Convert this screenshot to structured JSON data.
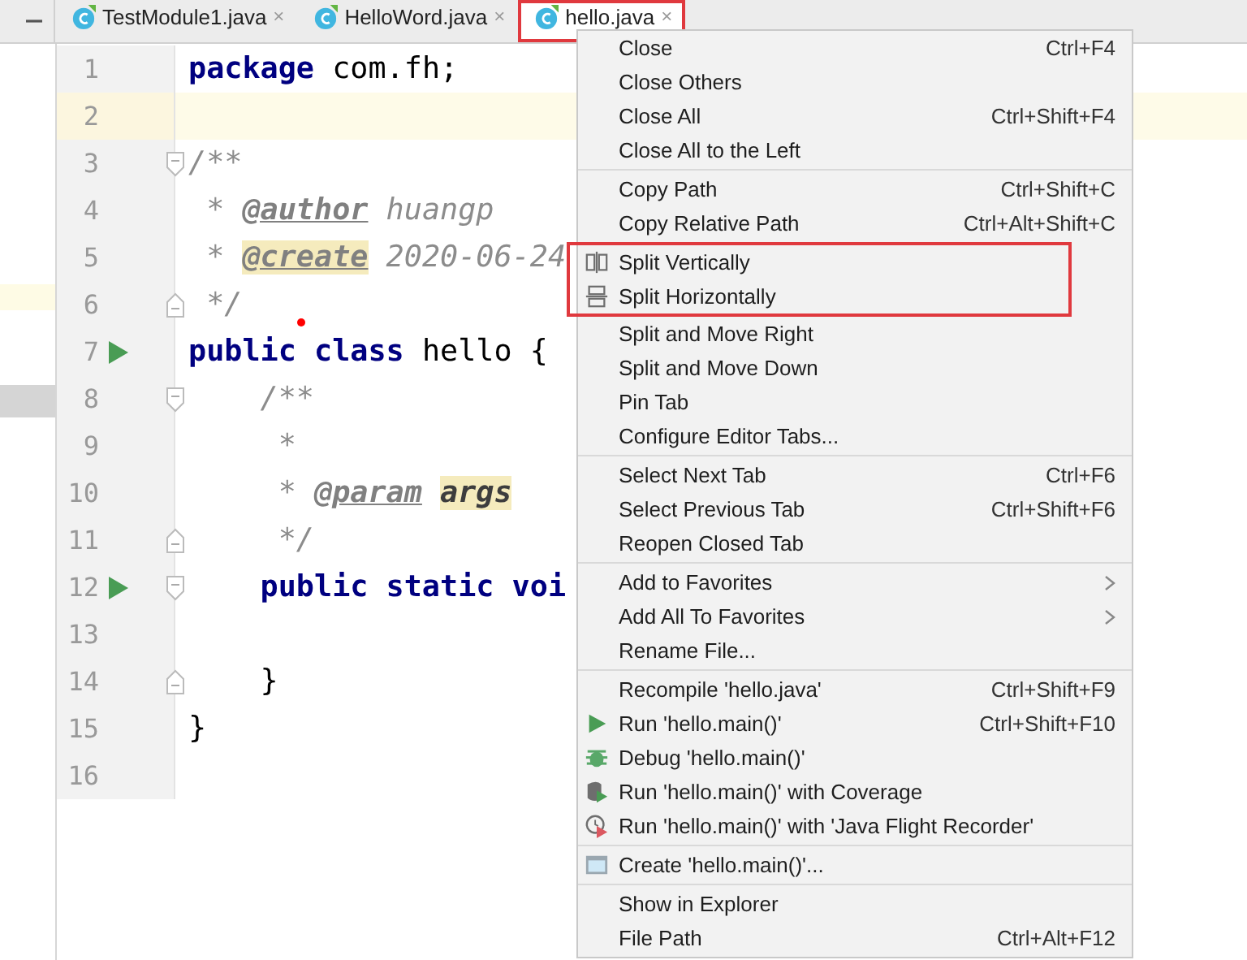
{
  "tabs": [
    {
      "label": "TestModule1.java",
      "close": "×",
      "selected": false,
      "outlined": false
    },
    {
      "label": "HelloWord.java",
      "close": "×",
      "selected": false,
      "outlined": false
    },
    {
      "label": "hello.java",
      "close": "×",
      "selected": true,
      "outlined": true
    }
  ],
  "editor": {
    "lines": [
      {
        "number": "1",
        "current": false,
        "run": false,
        "fold_start": false,
        "fold_end": false,
        "tokens": [
          {
            "kind": "keyword",
            "text": "package"
          },
          {
            "kind": "plain",
            "text": " com.fh;"
          }
        ]
      },
      {
        "number": "2",
        "current": true,
        "run": false,
        "fold_start": false,
        "fold_end": false
      },
      {
        "number": "3",
        "current": false,
        "run": false,
        "fold_start": true,
        "fold_end": false,
        "tokens": [
          {
            "kind": "comment",
            "text": "/**"
          }
        ]
      },
      {
        "number": "4",
        "current": false,
        "run": false,
        "fold_start": false,
        "fold_end": false,
        "tokens": [
          {
            "kind": "comment",
            "text": " * "
          },
          {
            "kind": "tag",
            "text": "@author"
          },
          {
            "kind": "comment",
            "text": " huangp"
          }
        ]
      },
      {
        "number": "5",
        "current": false,
        "run": false,
        "fold_start": false,
        "fold_end": false,
        "tokens": [
          {
            "kind": "comment",
            "text": " * "
          },
          {
            "kind": "tag-marked",
            "text": "@create"
          },
          {
            "kind": "comment",
            "text": " 2020-06-24"
          }
        ]
      },
      {
        "number": "6",
        "current": false,
        "run": false,
        "fold_start": false,
        "fold_end": true,
        "tokens": [
          {
            "kind": "comment",
            "text": " */"
          }
        ]
      },
      {
        "number": "7",
        "current": false,
        "run": true,
        "fold_start": false,
        "fold_end": false,
        "tokens": [
          {
            "kind": "keyword",
            "text": "public class"
          },
          {
            "kind": "plain",
            "text": " hello {"
          }
        ]
      },
      {
        "number": "8",
        "current": false,
        "run": false,
        "fold_start": true,
        "fold_end": false,
        "tokens": [
          {
            "kind": "comment",
            "text": "    /**"
          }
        ]
      },
      {
        "number": "9",
        "current": false,
        "run": false,
        "fold_start": false,
        "fold_end": false,
        "tokens": [
          {
            "kind": "comment",
            "text": "     *"
          }
        ]
      },
      {
        "number": "10",
        "current": false,
        "run": false,
        "fold_start": false,
        "fold_end": false,
        "tokens": [
          {
            "kind": "comment",
            "text": "     * "
          },
          {
            "kind": "tag",
            "text": "@param"
          },
          {
            "kind": "param-marked",
            "text": "args"
          }
        ]
      },
      {
        "number": "11",
        "current": false,
        "run": false,
        "fold_start": false,
        "fold_end": true,
        "tokens": [
          {
            "kind": "comment",
            "text": "     */"
          }
        ]
      },
      {
        "number": "12",
        "current": false,
        "run": true,
        "fold_start": true,
        "fold_end": false,
        "tokens": [
          {
            "kind": "keyword",
            "text": "    public static voi"
          }
        ]
      },
      {
        "number": "13",
        "current": false,
        "run": false,
        "fold_start": false,
        "fold_end": false
      },
      {
        "number": "14",
        "current": false,
        "run": false,
        "fold_start": false,
        "fold_end": true,
        "tokens": [
          {
            "kind": "plain",
            "text": "    }"
          }
        ]
      },
      {
        "number": "15",
        "current": false,
        "run": false,
        "fold_start": false,
        "fold_end": false,
        "tokens": [
          {
            "kind": "plain",
            "text": "}"
          }
        ]
      },
      {
        "number": "16",
        "current": false,
        "run": false,
        "fold_start": false,
        "fold_end": false
      }
    ]
  },
  "context_menu": {
    "sections": [
      {
        "outlined": false,
        "items": [
          {
            "kind": "text",
            "label": "Close",
            "shortcut": "Ctrl+F4",
            "submenu": false
          },
          {
            "kind": "text",
            "label": "Close Others",
            "submenu": false
          },
          {
            "kind": "text",
            "label": "Close All",
            "shortcut": "Ctrl+Shift+F4",
            "submenu": false
          },
          {
            "kind": "text",
            "label": "Close All to the Left",
            "submenu": false
          }
        ]
      },
      {
        "outlined": false,
        "items": [
          {
            "kind": "text",
            "label": "Copy Path",
            "shortcut": "Ctrl+Shift+C",
            "submenu": false
          },
          {
            "kind": "text",
            "label": "Copy Relative Path",
            "shortcut": "Ctrl+Alt+Shift+C",
            "submenu": false
          }
        ]
      },
      {
        "outlined": true,
        "items": [
          {
            "kind": "split-vertical",
            "label": "Split Vertically",
            "submenu": false
          },
          {
            "kind": "split-horizontal",
            "label": "Split Horizontally",
            "submenu": false
          }
        ]
      },
      {
        "outlined": false,
        "items": [
          {
            "kind": "text",
            "label": "Split and Move Right",
            "submenu": false
          },
          {
            "kind": "text",
            "label": "Split and Move Down",
            "submenu": false
          },
          {
            "kind": "text",
            "label": "Pin Tab",
            "submenu": false
          },
          {
            "kind": "text",
            "label": "Configure Editor Tabs...",
            "submenu": false
          }
        ]
      },
      {
        "outlined": false,
        "items": [
          {
            "kind": "text",
            "label": "Select Next Tab",
            "shortcut": "Ctrl+F6",
            "submenu": false
          },
          {
            "kind": "text",
            "label": "Select Previous Tab",
            "shortcut": "Ctrl+Shift+F6",
            "submenu": false
          },
          {
            "kind": "text",
            "label": "Reopen Closed Tab",
            "submenu": false
          }
        ]
      },
      {
        "outlined": false,
        "items": [
          {
            "kind": "text",
            "label": "Add to Favorites",
            "submenu": true
          },
          {
            "kind": "text",
            "label": "Add All To Favorites",
            "submenu": true
          },
          {
            "kind": "text",
            "label": "Rename File...",
            "submenu": false
          }
        ]
      },
      {
        "outlined": false,
        "items": [
          {
            "kind": "text",
            "label": "Recompile 'hello.java'",
            "shortcut": "Ctrl+Shift+F9",
            "submenu": false
          },
          {
            "kind": "run",
            "label": "Run 'hello.main()'",
            "shortcut": "Ctrl+Shift+F10",
            "submenu": false
          },
          {
            "kind": "debug",
            "label": "Debug 'hello.main()'",
            "submenu": false
          },
          {
            "kind": "coverage",
            "label": "Run 'hello.main()' with Coverage",
            "submenu": false
          },
          {
            "kind": "recorder",
            "label": "Run 'hello.main()' with 'Java Flight Recorder'",
            "submenu": false
          }
        ]
      },
      {
        "outlined": false,
        "items": [
          {
            "kind": "create",
            "label": "Create 'hello.main()'...",
            "submenu": false
          }
        ]
      },
      {
        "outlined": false,
        "items": [
          {
            "kind": "text",
            "label": "Show in Explorer",
            "submenu": false
          },
          {
            "kind": "text",
            "label": "File Path",
            "shortcut": "Ctrl+Alt+F12",
            "submenu": false
          }
        ]
      }
    ]
  }
}
